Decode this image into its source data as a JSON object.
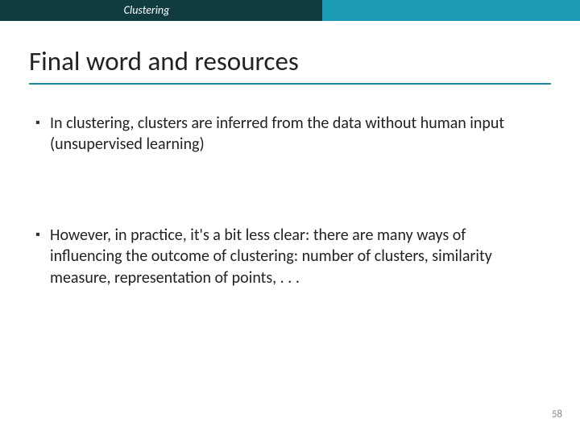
{
  "topbar": {
    "label": "Clustering"
  },
  "title": "Final word and resources",
  "bullets": [
    "In clustering, clusters are inferred from the data without human input (unsupervised learning)",
    "However, in practice, it's a bit less clear: there are many ways of influencing the outcome of clustering: number of clusters, similarity measure, representation of points, . . ."
  ],
  "page_number": "58"
}
